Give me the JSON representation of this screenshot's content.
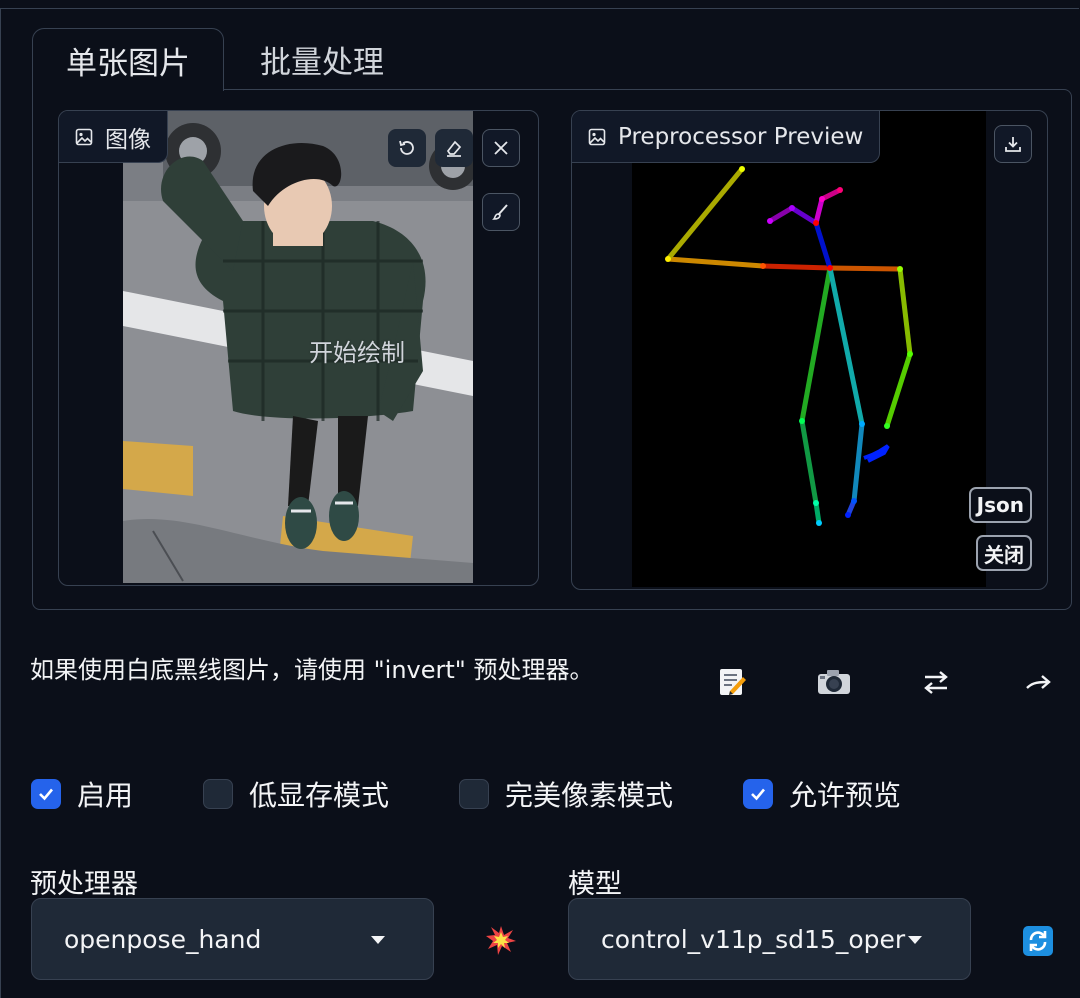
{
  "tabs": [
    {
      "label": "单张图片",
      "active": true
    },
    {
      "label": "批量处理",
      "active": false
    }
  ],
  "image_panel": {
    "label": "图像",
    "canvas_hint": "开始绘制",
    "icons": [
      "undo-icon",
      "eraser-icon",
      "close-icon",
      "brush-icon"
    ]
  },
  "preview_panel": {
    "label": "Preprocessor Preview",
    "json_button": "Json",
    "close_button": "关闭",
    "icons": [
      "download-icon"
    ]
  },
  "hint": "如果使用白底黑线图片，请使用 \"invert\" 预处理器。",
  "tool_icons": [
    "memo-icon",
    "camera-icon",
    "swap-icon",
    "send-arrow-icon"
  ],
  "options": [
    {
      "label": "启用",
      "checked": true
    },
    {
      "label": "低显存模式",
      "checked": false
    },
    {
      "label": "完美像素模式",
      "checked": false
    },
    {
      "label": "允许预览",
      "checked": true
    }
  ],
  "preprocessor": {
    "label": "预处理器",
    "value": "openpose_hand"
  },
  "model": {
    "label": "模型",
    "value": "control_v11p_sd15_oper"
  },
  "colors": {
    "accent": "#2563eb",
    "background": "#0b0f19",
    "panel": "#1f2937",
    "border": "#374151"
  }
}
